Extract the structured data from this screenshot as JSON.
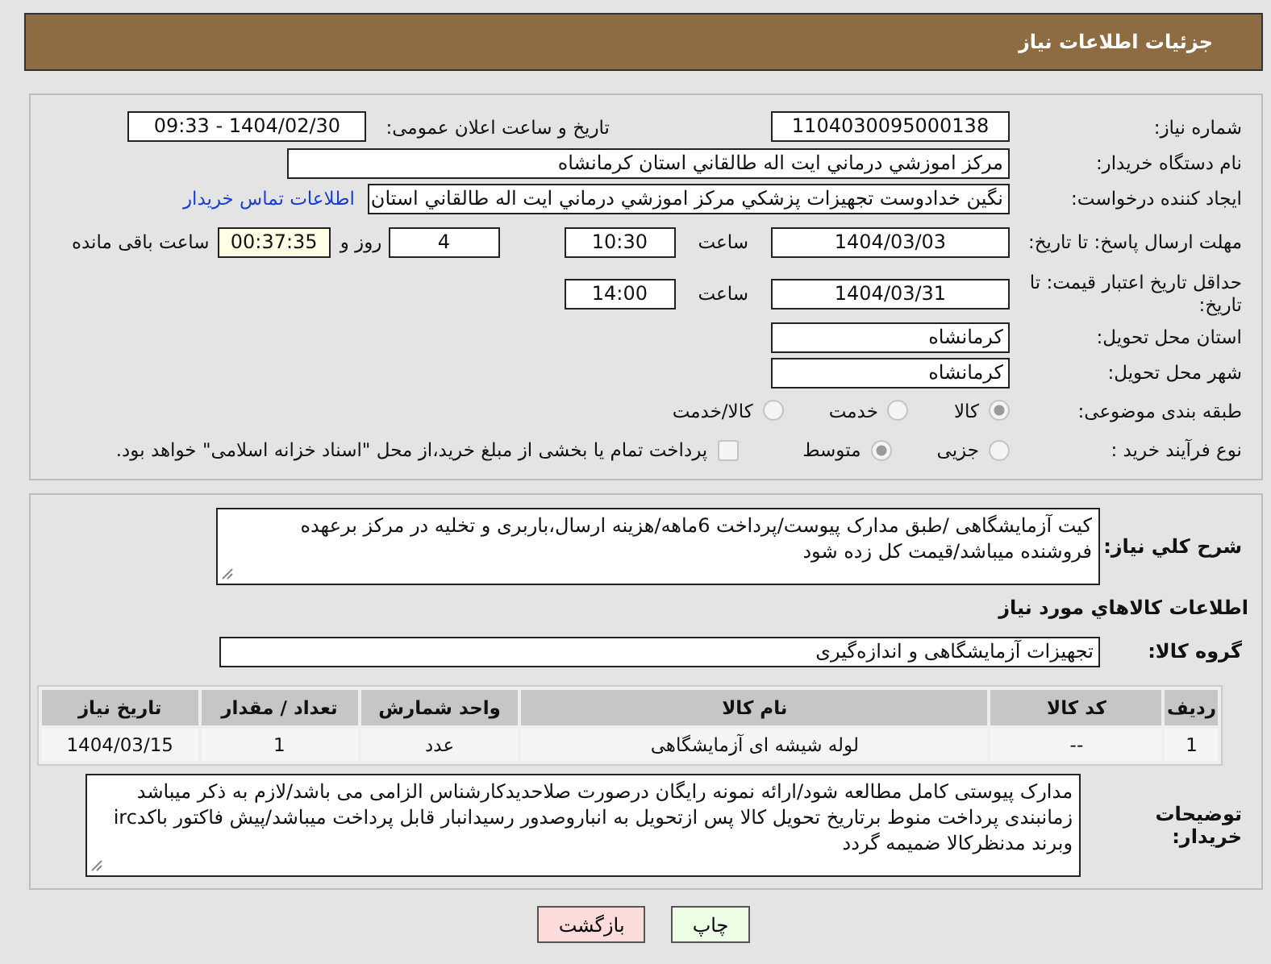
{
  "header": {
    "title": "جزئیات اطلاعات نیاز"
  },
  "need_number": {
    "label": "شماره نیاز:",
    "value": "1104030095000138"
  },
  "announce": {
    "label": "تاریخ و ساعت اعلان عمومی:",
    "value": "1404/02/30 - 09:33"
  },
  "buyer_org": {
    "label": "نام دستگاه خریدار:",
    "value": "مرکز اموزشي درماني ايت اله طالقاني استان کرمانشاه"
  },
  "requester": {
    "label": "ایجاد کننده درخواست:",
    "value": "نگين خدادوست تجهيزات پزشکي مرکز اموزشي درماني ايت اله طالقاني استان",
    "link": "اطلاعات تماس خریدار"
  },
  "deadline": {
    "label": "مهلت ارسال پاسخ: تا تاریخ:",
    "date": "1404/03/03",
    "time_label": "ساعت",
    "time": "10:30",
    "days": "4",
    "days_label": "روز و",
    "remaining": "00:37:35",
    "remaining_label": "ساعت باقی مانده"
  },
  "validity": {
    "label": "حداقل تاریخ اعتبار قیمت: تا تاریخ:",
    "date": "1404/03/31",
    "time_label": "ساعت",
    "time": "14:00"
  },
  "province": {
    "label": "استان محل تحویل:",
    "value": "کرمانشاه"
  },
  "city": {
    "label": "شهر محل تحویل:",
    "value": "کرمانشاه"
  },
  "category": {
    "label": "طبقه بندی موضوعی:",
    "options": [
      {
        "label": "کالا",
        "selected": true
      },
      {
        "label": "خدمت",
        "selected": false
      },
      {
        "label": "کالا/خدمت",
        "selected": false
      }
    ]
  },
  "purchase_type": {
    "label": "نوع فرآیند خرید :",
    "options": [
      {
        "label": "جزیی",
        "selected": false
      },
      {
        "label": "متوسط",
        "selected": true
      }
    ],
    "treasury": {
      "label": "پرداخت تمام یا بخشی از مبلغ خرید،از محل \"اسناد خزانه اسلامی\" خواهد بود.",
      "checked": false
    }
  },
  "description": {
    "label": "شرح كلي نياز:",
    "value": "کیت آزمایشگاهی /طبق مدارک پیوست/پرداخت 6ماهه/هزینه ارسال،باربری و تخلیه در مرکز برعهده فروشنده میباشد/قیمت کل زده شود"
  },
  "goods_title": "اطلاعات كالاهاي مورد نياز",
  "goods_group": {
    "label": "گروه كالا:",
    "value": "تجهیزات آزمایشگاهی و اندازه‌گیری"
  },
  "table": {
    "columns": [
      "ردیف",
      "کد کالا",
      "نام کالا",
      "واحد شمارش",
      "تعداد / مقدار",
      "تاریخ نیاز"
    ],
    "rows": [
      [
        "1",
        "--",
        "لوله شیشه ای آزمایشگاهی",
        "عدد",
        "1",
        "1404/03/15"
      ]
    ]
  },
  "buyer_notes": {
    "label": "توضیحات خریدار:",
    "value": "مدارک پیوستی کامل مطالعه شود/ارائه نمونه رایگان درصورت صلاحدیدکارشناس الزامی می باشد/لازم به ذکر میباشد زمانبندی پرداخت منوط برتاریخ تحویل کالا پس ازتحویل به انباروصدور رسیدانبار قابل پرداخت میباشد/پیش فاکتور باکدirc وبرند مدنظرکالا ضمیمه گردد"
  },
  "buttons": [
    {
      "label": "چاپ",
      "kind": "print"
    },
    {
      "label": "بازگشت",
      "kind": "back"
    }
  ]
}
